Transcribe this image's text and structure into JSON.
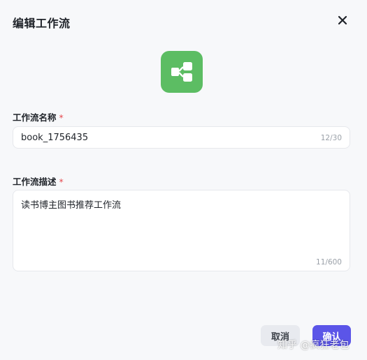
{
  "dialog": {
    "title": "编辑工作流",
    "close_icon": "close-icon",
    "app_icon": "workflow-icon"
  },
  "form": {
    "name_label": "工作流名称",
    "name_required": "*",
    "name_value": "book_1756435",
    "name_count": "12/30",
    "desc_label": "工作流描述",
    "desc_required": "*",
    "desc_value": "读书博主图书推荐工作流",
    "desc_count": "11/600"
  },
  "footer": {
    "cancel_label": "取消",
    "confirm_label": "确认"
  },
  "watermark": {
    "text": "知乎 @疯狂老包"
  },
  "colors": {
    "accent": "#5cbd63",
    "primary": "#5b55e8",
    "required": "#e5484d"
  }
}
